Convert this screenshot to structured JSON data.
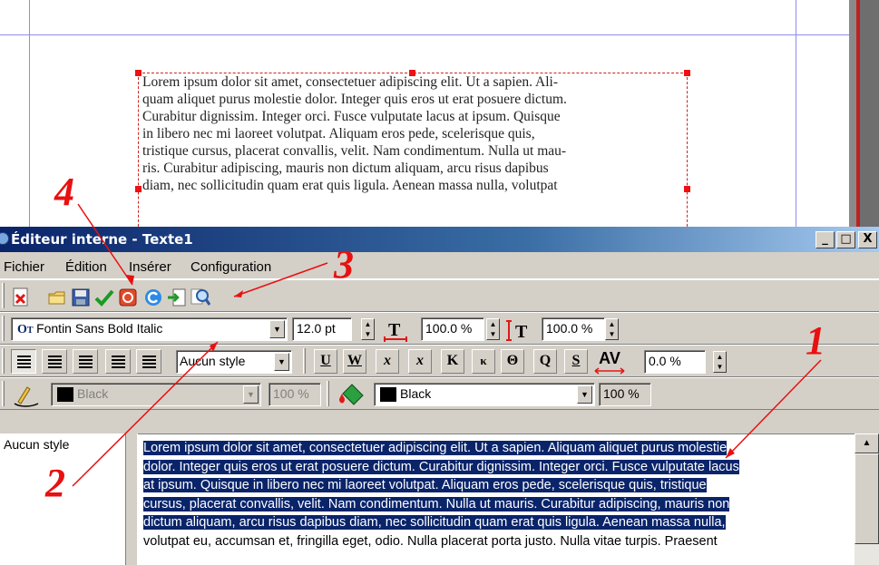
{
  "document": {
    "lines": [
      "Lorem ipsum dolor sit amet, consectetuer adipiscing elit. Ut a sapien. Ali-",
      "quam aliquet purus molestie dolor. Integer quis eros ut erat posuere dictum.",
      "Curabitur dignissim. Integer orci. Fusce vulputate lacus at ipsum. Quisque",
      "in libero nec mi laoreet volutpat. Aliquam eros pede, scelerisque quis,",
      "tristique cursus, placerat convallis, velit. Nam condimentum. Nulla ut mau-",
      "ris. Curabitur adipiscing, mauris non dictum aliquam, arcu risus dapibus",
      "diam, nec sollicitudin quam erat quis ligula. Aenean massa nulla, volutpat"
    ]
  },
  "window": {
    "title": "Éditeur interne - Texte1",
    "minimize_label": "_",
    "maximize_label": "□",
    "close_label": "X"
  },
  "menu": {
    "file": "Fichier",
    "edit": "Édition",
    "insert": "Insérer",
    "config": "Configuration"
  },
  "toolbar1": {
    "icons": [
      "close-doc-icon",
      "open-folder-icon",
      "save-icon",
      "apply-checkmark-icon",
      "stop-icon",
      "refresh-icon",
      "import-text-icon",
      "search-icon"
    ]
  },
  "font_bar": {
    "font_icon_label": "O",
    "font_icon_sub": "T",
    "font_name": "Fontin Sans Bold Italic",
    "font_size": "12.0 pt",
    "scale_h": "100.0 %",
    "scale_v": "100.0 %"
  },
  "para_bar": {
    "style": "Aucun style",
    "underline": "U",
    "word_underline": "W",
    "subscript": "x",
    "superscript": "x",
    "smallcaps": "K",
    "small_k": "κ",
    "strike": "Θ",
    "outline": "Q",
    "shadow": "S",
    "kerning": "AV",
    "kerning_value": "0.0 %"
  },
  "color_bar": {
    "stroke_color": "Black",
    "stroke_shade": "100 %",
    "fill_color": "Black",
    "fill_shade": "100 %"
  },
  "colors": {
    "selection": "#0a246a",
    "annotation_red": "#e81010",
    "title_blue": "#0a246a"
  },
  "styles_panel": {
    "label": "Aucun style"
  },
  "editor_text": {
    "selected_lines": [
      "Lorem ipsum dolor sit amet, consectetuer adipiscing elit. Ut a sapien. Aliquam aliquet purus molestie",
      "dolor. Integer quis eros ut erat posuere dictum. Curabitur dignissim. Integer orci. Fusce vulputate lacus",
      "at ipsum. Quisque in libero nec mi laoreet volutpat. Aliquam eros pede, scelerisque quis, tristique",
      "cursus, placerat convallis, velit. Nam condimentum. Nulla ut mauris. Curabitur adipiscing, mauris non",
      "dictum aliquam, arcu risus dapibus diam, nec sollicitudin quam erat quis ligula. Aenean massa nulla,"
    ],
    "unselected_line": "volutpat eu, accumsan et, fringilla eget, odio. Nulla placerat porta justo. Nulla vitae turpis. Praesent"
  },
  "annotations": {
    "n1": "1",
    "n2": "2",
    "n3": "3",
    "n4": "4"
  }
}
